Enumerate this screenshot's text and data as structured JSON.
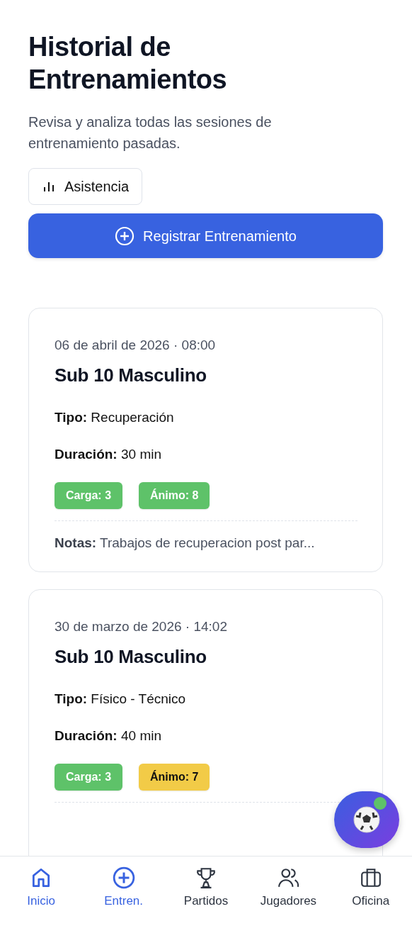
{
  "header": {
    "title": "Historial de Entrenamientos",
    "subtitle": "Revisa y analiza todas las sesiones de entrenamiento pasadas."
  },
  "actions": {
    "attendance_button": "Asistencia",
    "register_button": "Registrar Entrenamiento"
  },
  "sessions": [
    {
      "date": "06 de abril de 2026 · 08:00",
      "team": "Sub 10 Masculino",
      "type_label": "Tipo:",
      "type": "Recuperación",
      "duration_label": "Duración:",
      "duration": "30 min",
      "tags": [
        {
          "label": "Carga: 3",
          "color": "#5ec269"
        },
        {
          "label": "Ánimo: 8",
          "color": "#5ec269"
        }
      ],
      "notes_label": "Notas:",
      "notes": "Trabajos de recuperacion post par..."
    },
    {
      "date": "30 de marzo de 2026 · 14:02",
      "team": "Sub 10 Masculino",
      "type_label": "Tipo:",
      "type": "Físico - Técnico",
      "duration_label": "Duración:",
      "duration": "40 min",
      "tags": [
        {
          "label": "Carga: 3",
          "color": "#5ec269"
        },
        {
          "label": "Ánimo: 7",
          "color": "#f2cb47"
        }
      ]
    }
  ],
  "assistant_button": {
    "online": true
  },
  "bottom_nav": [
    {
      "label": "Inicio",
      "kind": "home",
      "selected": true
    },
    {
      "label": "Entren.",
      "kind": "plus",
      "selected": true
    },
    {
      "label": "Partidos",
      "kind": "trophy",
      "selected": false
    },
    {
      "label": "Jugadores",
      "kind": "users",
      "selected": false
    },
    {
      "label": "Oficina",
      "kind": "briefcase",
      "selected": false
    }
  ]
}
